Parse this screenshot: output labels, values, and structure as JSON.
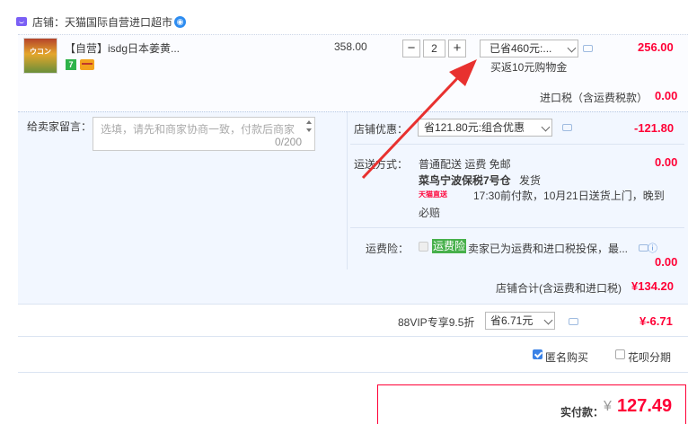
{
  "shop": {
    "label": "店铺：天猫国际自营进口超市"
  },
  "item": {
    "thumb_text": "ウコン",
    "title": "【自营】isdg日本姜黄...",
    "badge": "7",
    "price": "358.00",
    "qty": "2",
    "qty_minus": "−",
    "qty_plus": "+",
    "promo_selected": "已省460元:...",
    "promo_note": "买返10元购物金",
    "subtotal": "256.00",
    "import_tax_label": "进口税（含运费税款）",
    "import_tax_value": "0.00"
  },
  "options": {
    "message_label": "给卖家留言：",
    "message_placeholder": "选填，请先和商家协商一致，付款后商家",
    "message_count": "0/200",
    "shop_promo_label": "店铺优惠：",
    "shop_promo_selected": "省121.80元:组合优惠",
    "shop_promo_value": "-121.80",
    "shipping_label": "运送方式：",
    "shipping_method": "普通配送 运费 免邮",
    "shipping_value": "0.00",
    "warehouse": "菜鸟宁波保税7号仓",
    "ship_action": "发货",
    "tmall_logo": "天猫直送",
    "delivery_line1": "17:30前付款，10月21日送货上门，晚到",
    "delivery_line2": "必赔",
    "insurance_label": "运费险：",
    "insurance_tag": "运费险",
    "insurance_text": "卖家已为运费和进口税投保，最...",
    "insurance_value": "0.00",
    "shop_total_label": "店铺合计(含运费和进口税)",
    "shop_total_value": "¥134.20"
  },
  "vip": {
    "label": "88VIP专享9.5折",
    "selected": "省6.71元",
    "value": "¥-6.71"
  },
  "checkout": {
    "anonymous_label": "匿名购买",
    "huabei_label": "花呗分期",
    "pay_label": "实付款：",
    "currency": "¥",
    "pay_value": "127.49"
  },
  "colors": {
    "accent_red": "#ff0036",
    "panel_blue": "#f2f7ff",
    "arrow_red": "#e8312f"
  }
}
